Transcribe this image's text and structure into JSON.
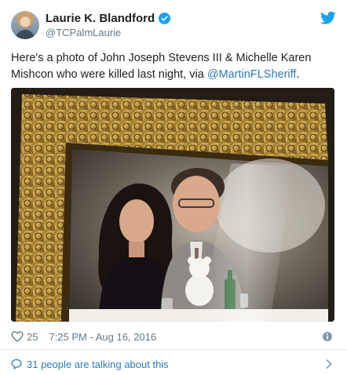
{
  "tweet": {
    "display_name": "Laurie K. Blandford",
    "handle": "@TCPalmLaurie",
    "text": "Here's a photo of John Joseph Stevens III & Michelle Karen Mishcon who were killed last night, via ",
    "mention": "@MartinFLSheriff",
    "text_end": ".",
    "likes": "25",
    "timestamp": "7:25 PM - Aug 16, 2016",
    "conversation": "31 people are talking about this"
  },
  "icons": {
    "verified": "verified-badge-icon",
    "twitter": "twitter-bird-icon",
    "like": "heart-icon",
    "info": "info-icon",
    "conversation": "speech-bubble-icon",
    "more": "chevron-right-icon"
  },
  "colors": {
    "brand_blue": "#1da1f2",
    "link_blue": "#2b7bb9",
    "text": "#1c2022",
    "secondary": "#697882",
    "divider": "#e1e8ed"
  }
}
